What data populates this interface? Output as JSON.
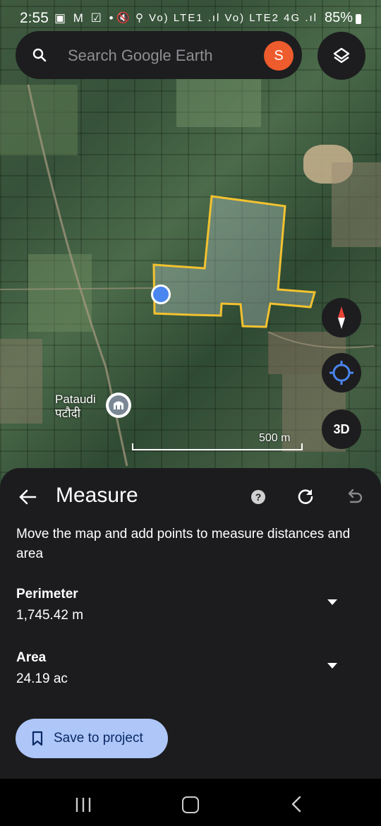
{
  "status_bar": {
    "time": "2:55",
    "left_icons": "▣ M ☑ •",
    "right_icons": "🔇 ⚲ Vo) LTE1 .ıl Vo) LTE2 4G .ıl",
    "battery": "85%"
  },
  "search": {
    "placeholder": "Search Google Earth",
    "avatar_initial": "S"
  },
  "map": {
    "place_name": "Pataudi",
    "place_name_local": "पटौदी",
    "scale_label": "500 m",
    "three_d_label": "3D",
    "polygon_color": "#f2c230"
  },
  "measure": {
    "title": "Measure",
    "help_symbol": "?",
    "description": "Move the map and add points to measure distances and area",
    "perimeter_label": "Perimeter",
    "perimeter_value": "1,745.42 m",
    "area_label": "Area",
    "area_value": "24.19 ac",
    "save_label": "Save to project"
  },
  "colors": {
    "sheet_bg": "#1c1c1e",
    "save_button_bg": "#aec6f8",
    "avatar_bg": "#ee5b2c",
    "compass_red": "#e84335",
    "point_blue": "#4a86f0"
  }
}
